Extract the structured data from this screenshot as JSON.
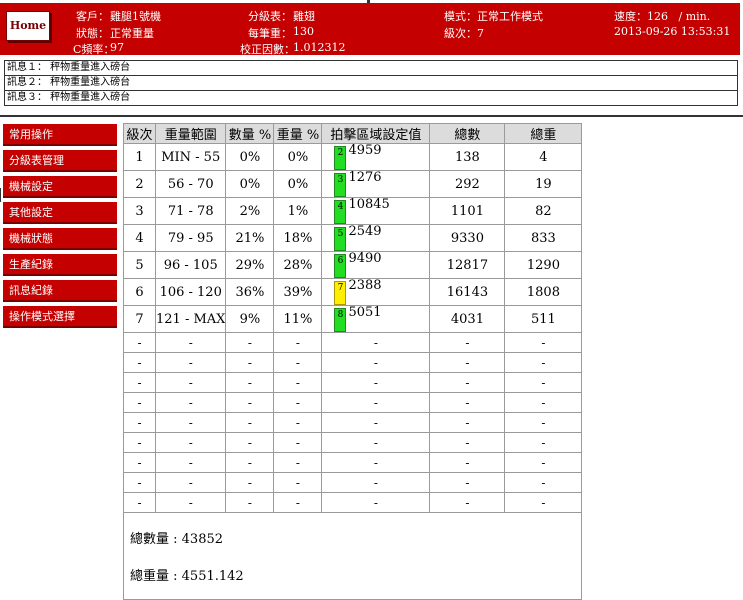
{
  "header": {
    "home_label": "Home",
    "customer_label": "客戶：",
    "customer_value": "雞腿1號機",
    "status_label": "狀態：",
    "status_value": "正常重量",
    "cfreq_label": "C頻率：",
    "cfreq_value": "97",
    "grade_table_label": "分級表：",
    "grade_table_value": "雞翅",
    "per_weight_label": "每筆重：",
    "per_weight_value": "130",
    "calib_label": "校正因數：",
    "calib_value": "1.012312",
    "mode_label": "模式：",
    "mode_value": "正常工作模式",
    "level_label": "級次：",
    "level_value": "7",
    "speed_label": "速度：",
    "speed_value": "126",
    "speed_unit": "/ min.",
    "datetime": "2013-09-26 13:53:31"
  },
  "messages": [
    "訊息１： 秤物重量進入磅台",
    "訊息２： 秤物重量進入磅台",
    "訊息３： 秤物重量進入磅台"
  ],
  "sidebar": {
    "items": [
      {
        "label": "常用操作"
      },
      {
        "label": "分級表管理"
      },
      {
        "label": "機械設定"
      },
      {
        "label": "其他設定"
      },
      {
        "label": "機械狀態"
      },
      {
        "label": "生產紀錄"
      },
      {
        "label": "訊息紀錄"
      },
      {
        "label": "操作模式選擇"
      }
    ]
  },
  "table": {
    "headers": [
      "級次",
      "重量範圍",
      "數量 %",
      "重量 %",
      "拍擊區域設定值",
      "總數",
      "總重"
    ],
    "rows": [
      {
        "level": "1",
        "range": "MIN - 55",
        "qty_pct": "0%",
        "wt_pct": "0%",
        "slot": "2",
        "slot_color": "green",
        "setting": "4959",
        "count": "138",
        "weight": "4"
      },
      {
        "level": "2",
        "range": "56 - 70",
        "qty_pct": "0%",
        "wt_pct": "0%",
        "slot": "3",
        "slot_color": "green",
        "setting": "1276",
        "count": "292",
        "weight": "19"
      },
      {
        "level": "3",
        "range": "71 - 78",
        "qty_pct": "2%",
        "wt_pct": "1%",
        "slot": "4",
        "slot_color": "green",
        "setting": "10845",
        "count": "1101",
        "weight": "82"
      },
      {
        "level": "4",
        "range": "79 - 95",
        "qty_pct": "21%",
        "wt_pct": "18%",
        "slot": "5",
        "slot_color": "green",
        "setting": "2549",
        "count": "9330",
        "weight": "833"
      },
      {
        "level": "5",
        "range": "96 - 105",
        "qty_pct": "29%",
        "wt_pct": "28%",
        "slot": "6",
        "slot_color": "green",
        "setting": "9490",
        "count": "12817",
        "weight": "1290"
      },
      {
        "level": "6",
        "range": "106 - 120",
        "qty_pct": "36%",
        "wt_pct": "39%",
        "slot": "7",
        "slot_color": "yellow",
        "setting": "2388",
        "count": "16143",
        "weight": "1808"
      },
      {
        "level": "7",
        "range": "121 - MAX",
        "qty_pct": "9%",
        "wt_pct": "11%",
        "slot": "8",
        "slot_color": "green",
        "setting": "5051",
        "count": "4031",
        "weight": "511"
      }
    ],
    "empty_placeholder": "-",
    "empty_row_count": 9,
    "total_count_label": "總數量 : ",
    "total_count_value": "43852",
    "total_weight_label": "總重量 : ",
    "total_weight_value": "4551.142"
  },
  "colors": {
    "header_bg": "#c40000",
    "sidebar_bg": "#c40000",
    "slot_green": "#22dd22",
    "slot_yellow": "#ffee00",
    "table_header_bg": "#dcdcdc"
  }
}
